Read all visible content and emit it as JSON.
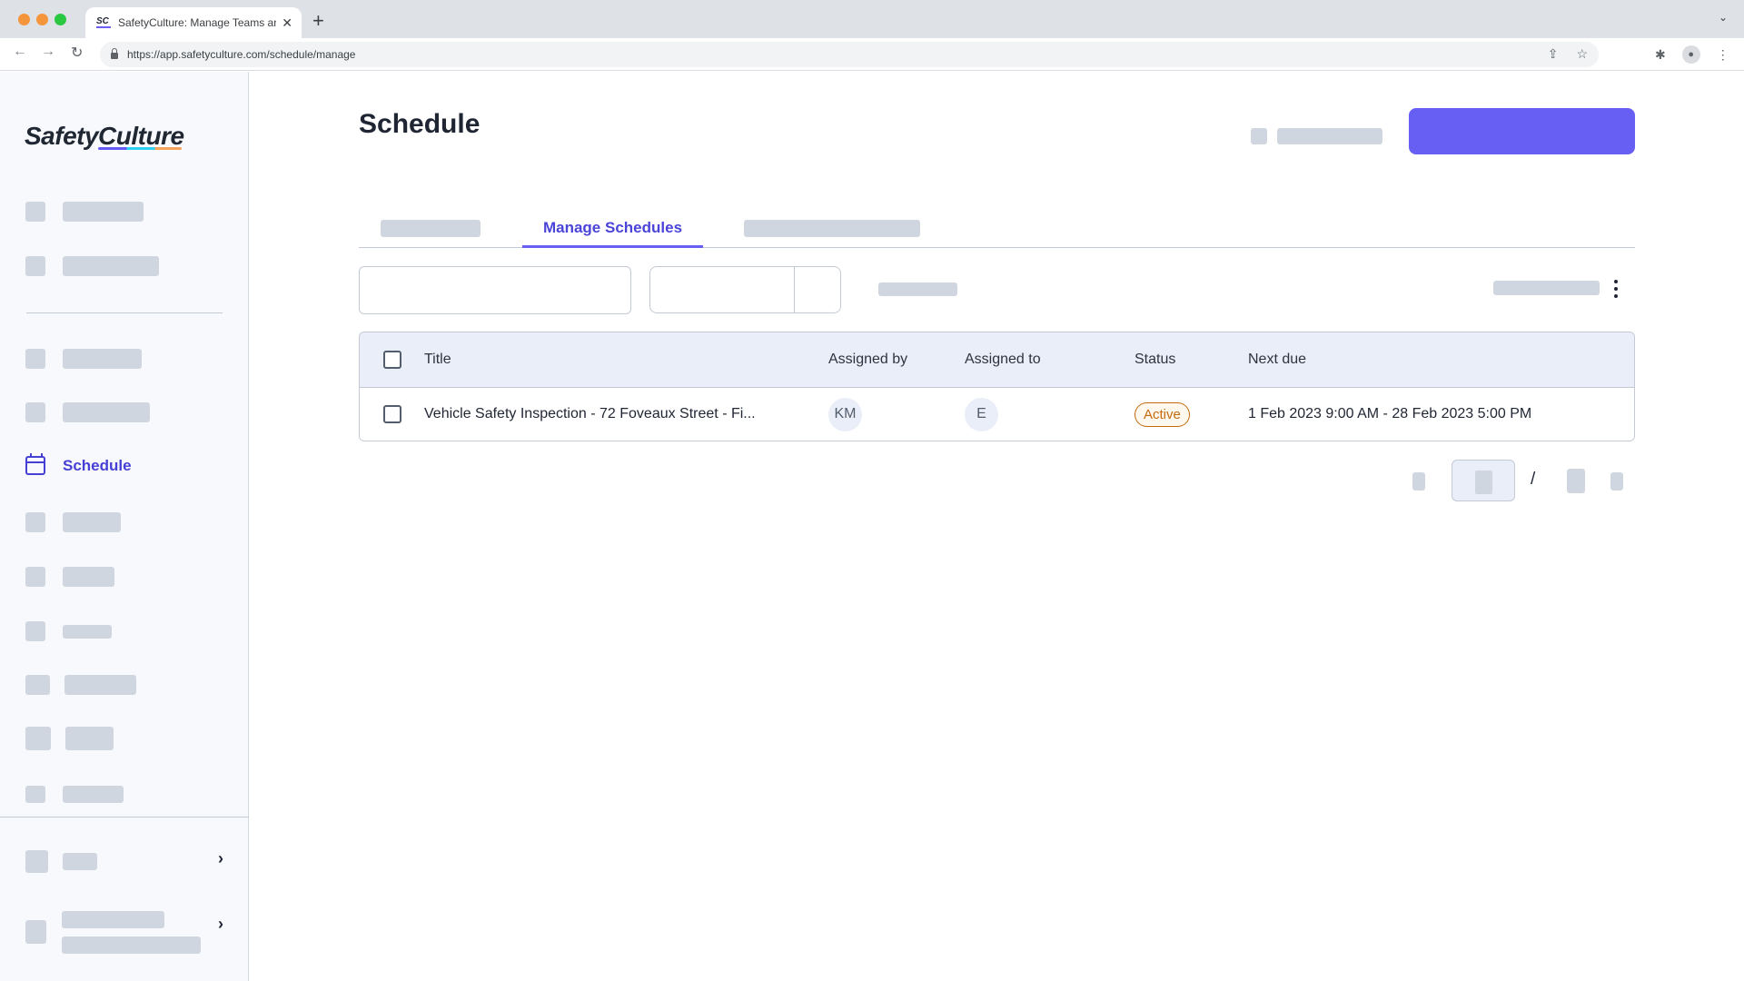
{
  "browser": {
    "tab_title": "SafetyCulture: Manage Teams and ...",
    "favicon_text": "SC",
    "close_glyph": "✕",
    "new_tab_glyph": "+",
    "url": "https://app.safetyculture.com/schedule/manage",
    "back_glyph": "←",
    "forward_glyph": "→",
    "reload_glyph": "↻",
    "share_glyph": "⇪",
    "bookmark_glyph": "☆",
    "extensions_glyph": "✱",
    "profile_glyph": "●",
    "menu_glyph": "⋮",
    "tabstrip_chevron": "⌄"
  },
  "sidebar": {
    "logo": "SafetyCulture",
    "active_item": {
      "label": "Schedule",
      "icon": "calendar-icon"
    },
    "expand_glyph": "›"
  },
  "header": {
    "title": "Schedule"
  },
  "tabs": [
    {
      "label": "",
      "placeholder": true
    },
    {
      "label": "Manage Schedules",
      "active": true
    },
    {
      "label": "",
      "placeholder": true
    }
  ],
  "table": {
    "columns": [
      "Title",
      "Assigned by",
      "Assigned to",
      "Status",
      "Next due"
    ],
    "rows": [
      {
        "title": "Vehicle Safety Inspection - 72 Foveaux Street - Fi...",
        "assigned_by": "KM",
        "assigned_to": "E",
        "status": "Active",
        "next_due": "1 Feb 2023 9:00 AM - 28 Feb 2023 5:00 PM"
      }
    ]
  },
  "pagination": {
    "separator": "/"
  },
  "colors": {
    "accent": "#675ff3",
    "active_nav": "#4740d4",
    "status_active": "#c46a0d",
    "placeholder": "#d0d6df"
  }
}
